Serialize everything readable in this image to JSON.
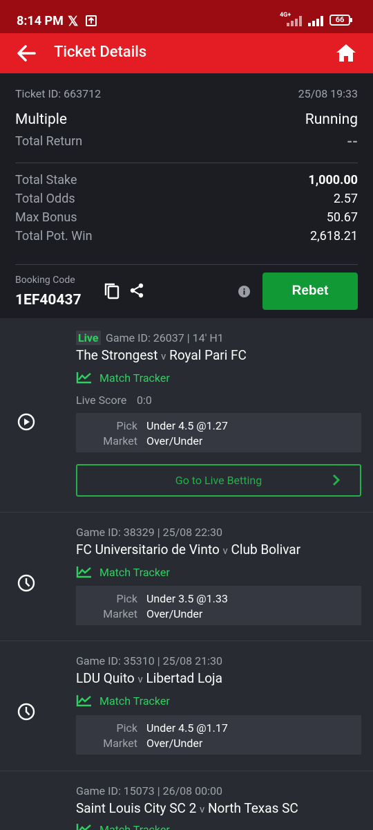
{
  "status_bar": {
    "time": "8:14 PM",
    "x_logo": "𝕏",
    "network": "4G+",
    "battery": "66"
  },
  "app_bar": {
    "title": "Ticket Details"
  },
  "ticket": {
    "id": "Ticket ID: 663712",
    "datetime": "25/08 19:33",
    "type": "Multiple",
    "status": "Running",
    "total_return_label": "Total Return",
    "total_return_value": "--",
    "rows": [
      {
        "label": "Total Stake",
        "value": "1,000.00"
      },
      {
        "label": "Total Odds",
        "value": "2.57"
      },
      {
        "label": "Max Bonus",
        "value": "50.67"
      },
      {
        "label": "Total Pot. Win",
        "value": "2,618.21"
      }
    ],
    "booking_label": "Booking Code",
    "booking_code": "1EF40437",
    "rebet_label": "Rebet"
  },
  "selections": [
    {
      "live": "Live",
      "meta": "Game ID: 26037 | 14' H1",
      "home": "The Strongest",
      "away": "Royal Pari FC",
      "tracker": "Match Tracker",
      "score_label": "Live Score",
      "score": "0:0",
      "pick_label": "Pick",
      "pick": "Under 4.5 @1.27",
      "market_label": "Market",
      "market": "Over/Under",
      "cta": "Go to Live Betting"
    },
    {
      "meta": "Game ID: 38329 | 25/08 22:30",
      "home": "FC Universitario de Vinto",
      "away": "Club Bolivar",
      "tracker": "Match Tracker",
      "pick_label": "Pick",
      "pick": "Under 3.5 @1.33",
      "market_label": "Market",
      "market": "Over/Under"
    },
    {
      "meta": "Game ID: 35310 | 25/08 21:30",
      "home": "LDU Quito",
      "away": "Libertad Loja",
      "tracker": "Match Tracker",
      "pick_label": "Pick",
      "pick": "Under 4.5 @1.17",
      "market_label": "Market",
      "market": "Over/Under"
    },
    {
      "meta": "Game ID: 15073 | 26/08 00:00",
      "home": "Saint Louis City SC 2",
      "away": "North Texas SC",
      "tracker": "Match Tracker"
    }
  ],
  "vs": "v",
  "colors": {
    "status_bar": "#9b0c12",
    "app_bar": "#e41c24",
    "accent_green": "#2ed160",
    "rebet": "#119935"
  },
  "icons": [
    "back-arrow-icon",
    "home-icon",
    "copy-icon",
    "share-icon",
    "info-icon",
    "play-icon",
    "clock-icon",
    "chart-line-icon",
    "chevron-right-icon"
  ]
}
